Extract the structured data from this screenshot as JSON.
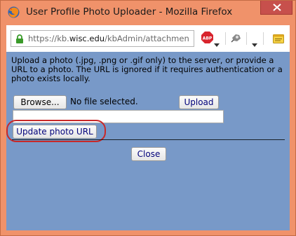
{
  "window": {
    "title": "User Profile Photo Uploader - Mozilla Firefox"
  },
  "urlbar": {
    "url_prefix": "https://kb.",
    "url_domain": "wisc.edu",
    "url_path": "/kbAdmin/attachments/",
    "icons": [
      "lock-icon",
      "adblock-plus-icon",
      "plugin-icon",
      "menu-arrow-icon",
      "notes-icon"
    ]
  },
  "content": {
    "intro_text": "Upload a photo (.jpg, .png or .gif only) to the server, or provide a URL to a photo. The URL is ignored if it requires authentication or a photo exists locally.",
    "browse_label": "Browse...",
    "file_status": "No file selected.",
    "upload_label": "Upload",
    "photo_url_value": "",
    "update_url_label": "Update photo URL",
    "close_label": "Close"
  },
  "colors": {
    "title_bar": "#f0926a",
    "close_button": "#c7504c",
    "content_background": "#7899c8",
    "highlight": "#c82828"
  }
}
